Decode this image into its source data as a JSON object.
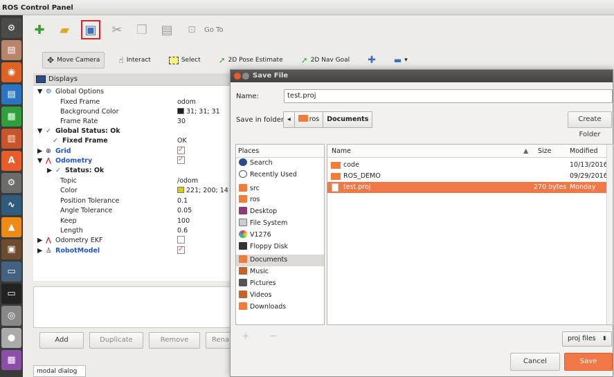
{
  "window": {
    "title": "ROS Control Panel"
  },
  "launcher": {
    "icons": [
      "ubuntu-dash-icon",
      "files-icon",
      "firefox-icon",
      "writer-icon",
      "calc-icon",
      "impress-icon",
      "software-center-icon",
      "settings-icon",
      "system-monitor-icon",
      "vlc-icon",
      "terminal-app-icon",
      "panel-icon",
      "terminal-icon",
      "disk-icon",
      "dvd-icon",
      "workspace-icon"
    ]
  },
  "toolbar": {
    "goto_label": "Go To",
    "tools": {
      "move_camera": "Move Camera",
      "interact": "Interact",
      "select": "Select",
      "pose_estimate": "2D Pose Estimate",
      "nav_goal": "2D Nav Goal"
    }
  },
  "displays": {
    "header": "Displays",
    "global_options": "Global Options",
    "fixed_frame_label": "Fixed Frame",
    "fixed_frame_value": "odom",
    "background_color_label": "Background Color",
    "background_color_value": "31; 31; 31",
    "frame_rate_label": "Frame Rate",
    "frame_rate_value": "30",
    "global_status": "Global Status: Ok",
    "fixed_frame_status": "Fixed Frame",
    "fixed_frame_status_value": "OK",
    "grid": "Grid",
    "odometry": "Odometry",
    "odometry_status": "Status: Ok",
    "topic_label": "Topic",
    "topic_value": "/odom",
    "color_label": "Color",
    "color_value": "221; 200; 14",
    "position_tolerance_label": "Position Tolerance",
    "position_tolerance_value": "0.1",
    "angle_tolerance_label": "Angle Tolerance",
    "angle_tolerance_value": "0.05",
    "keep_label": "Keep",
    "keep_value": "100",
    "length_label": "Length",
    "length_value": "0.6",
    "odometry_ekf": "Odometry EKF",
    "robot_model": "RobotModel"
  },
  "panel_buttons": {
    "add": "Add",
    "duplicate": "Duplicate",
    "remove": "Remove",
    "rename": "Rena"
  },
  "bottom_tab": "modal dialog",
  "dialog": {
    "title": "Save File",
    "name_label": "Name:",
    "name_value": "test.proj",
    "save_in_label": "Save in folder:",
    "path_back": "◂",
    "path_segments": [
      "ros",
      "Documents"
    ],
    "create_folder": "Create Folder",
    "places_header": "Places",
    "places": [
      "Search",
      "Recently Used",
      "src",
      "ros",
      "Desktop",
      "File System",
      "V1276",
      "Floppy Disk",
      "Documents",
      "Music",
      "Pictures",
      "Videos",
      "Downloads"
    ],
    "places_add_remove": "+ −",
    "columns": {
      "name": "Name",
      "size": "Size",
      "modified": "Modified"
    },
    "files": [
      {
        "name": "code",
        "size": "",
        "modified": "10/13/2016"
      },
      {
        "name": "ROS_DEMO",
        "size": "",
        "modified": "09/29/2016"
      },
      {
        "name": "test.proj",
        "size": "270 bytes",
        "modified": "Monday"
      }
    ],
    "filter": "proj files",
    "cancel": "Cancel",
    "save": "Save"
  },
  "colors": {
    "accent": "#f07746",
    "selection_orange": "#f07746",
    "launcher_bg": "#3a3a38",
    "highlight_red": "#e0202a",
    "link_blue": "#1f57c8"
  }
}
